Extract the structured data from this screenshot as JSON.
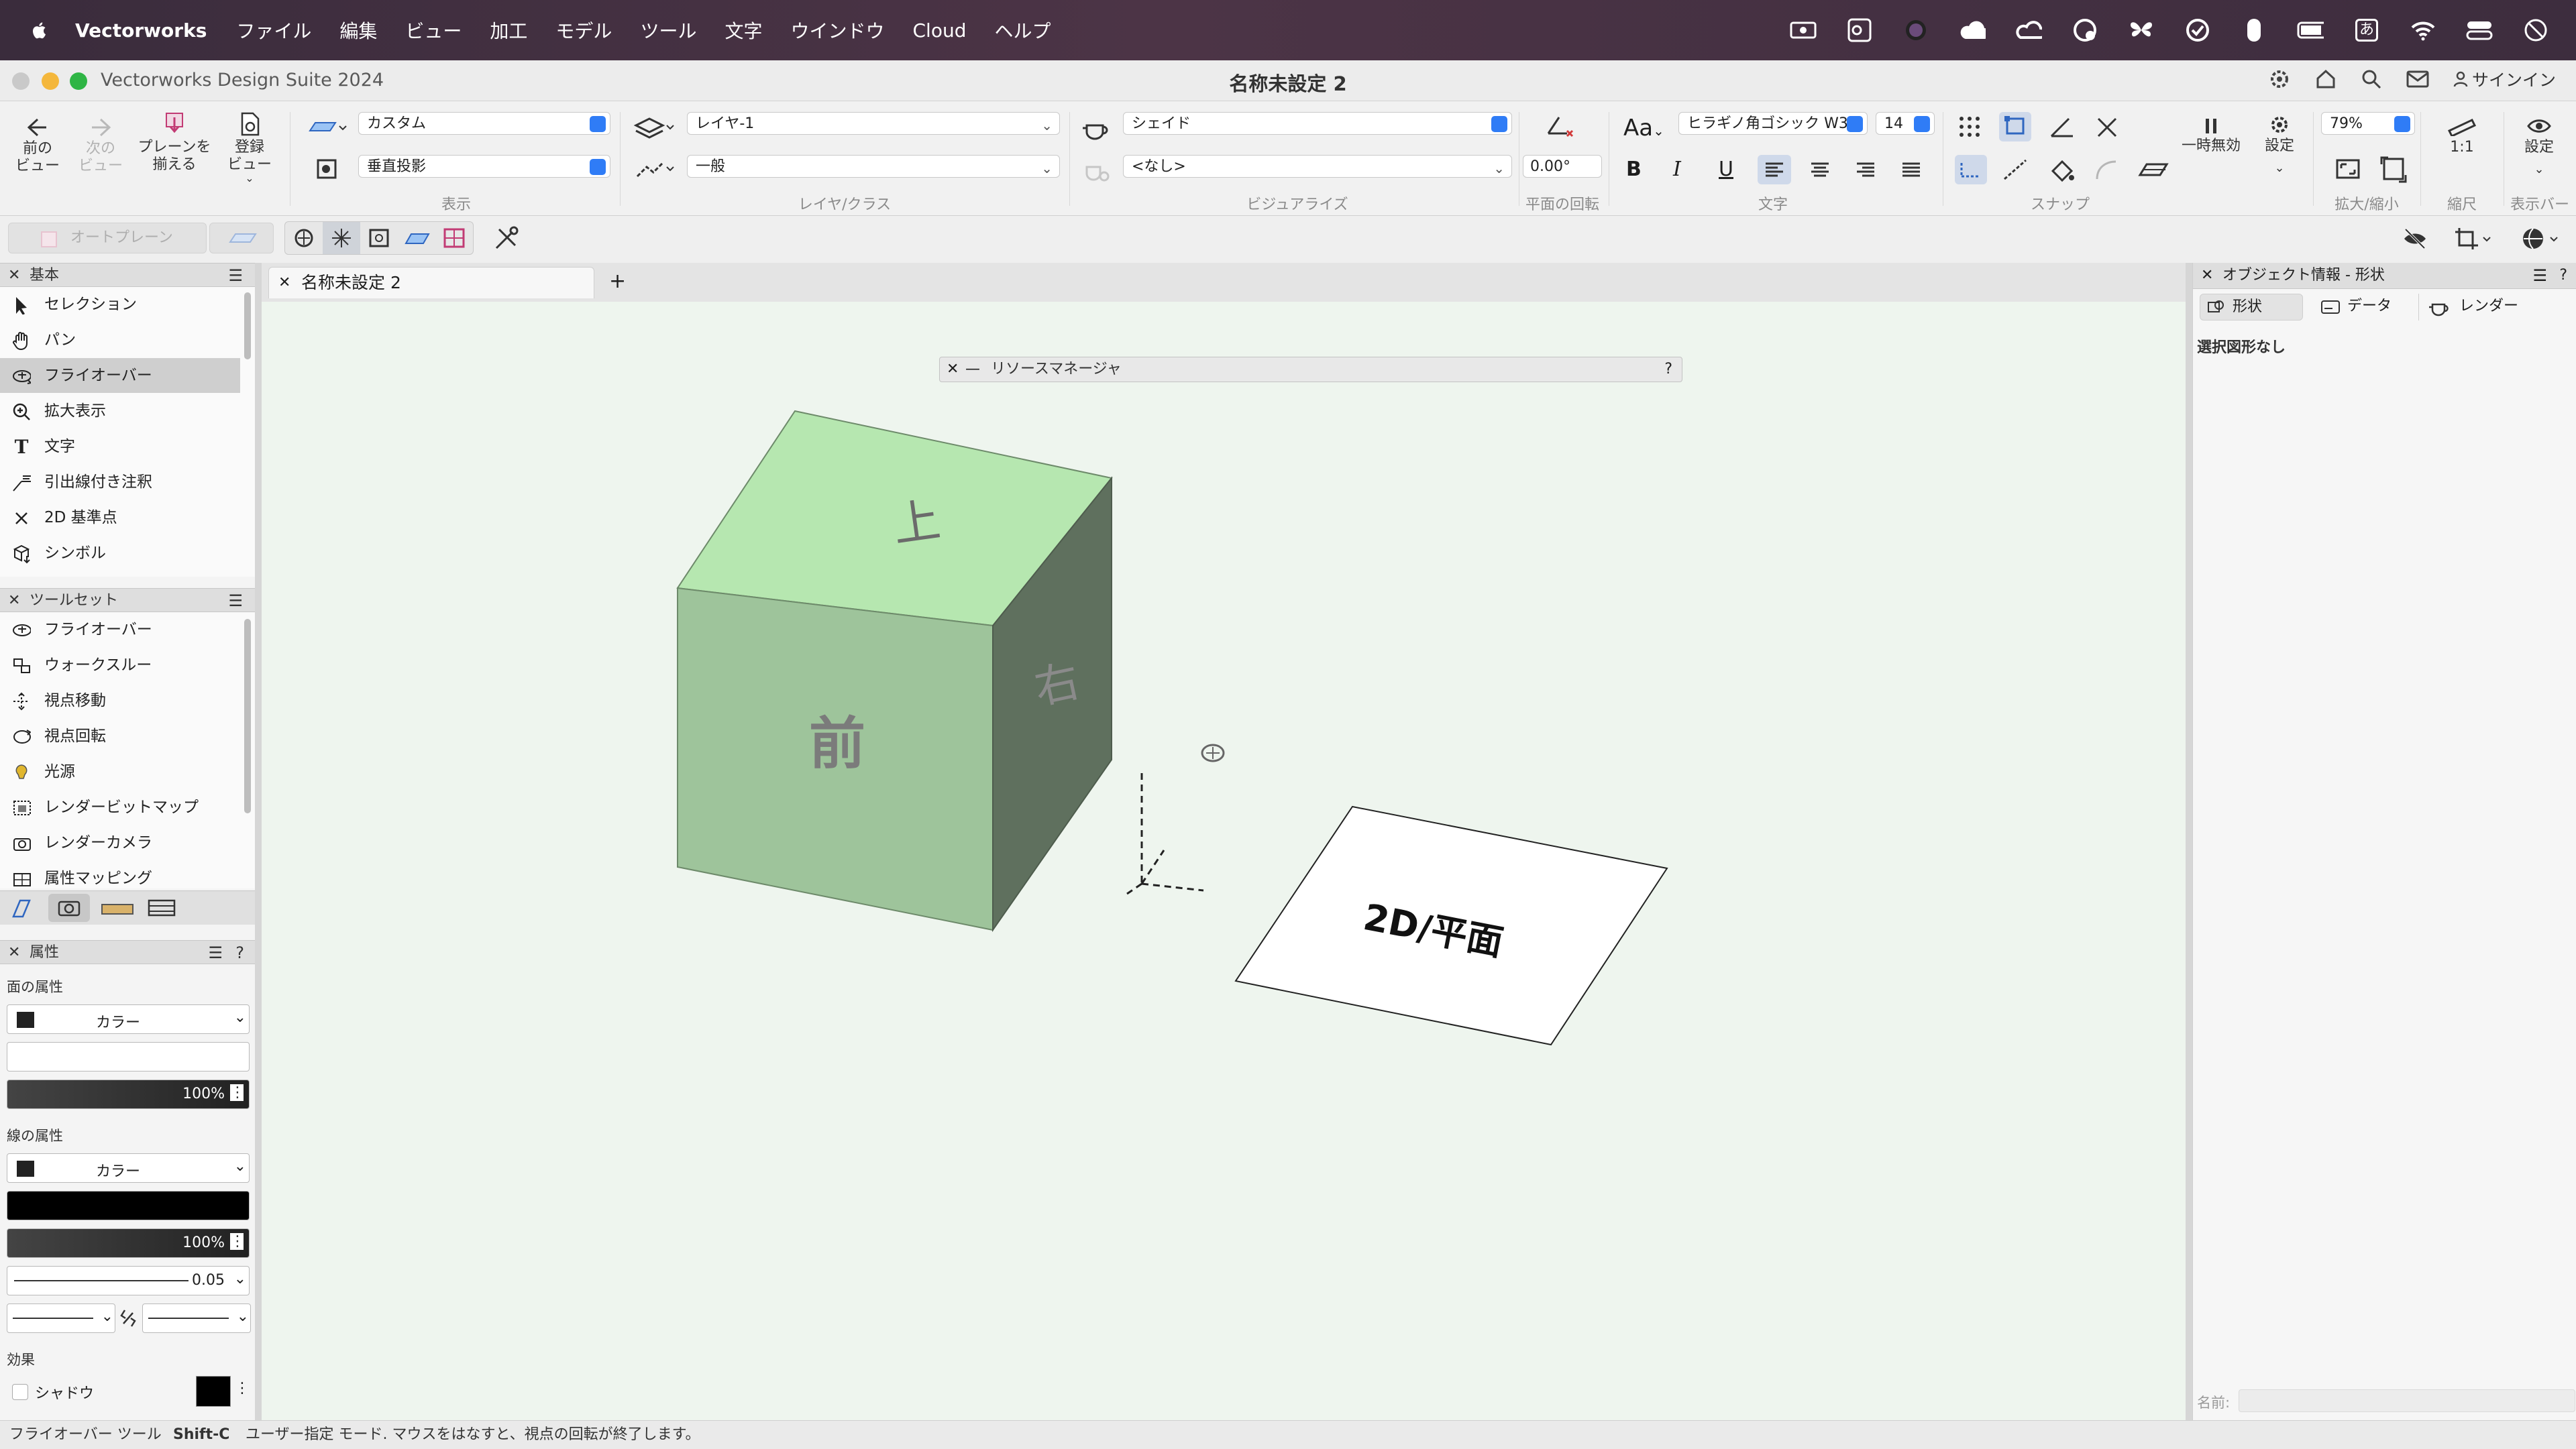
{
  "menubar": {
    "app_name": "Vectorworks",
    "items": [
      "ファイル",
      "編集",
      "ビュー",
      "加工",
      "モデル",
      "ツール",
      "文字",
      "ウインドウ",
      "Cloud",
      "ヘルプ"
    ],
    "status_icons": [
      "screen-record-icon",
      "outlook-icon",
      "siri-orb-icon",
      "cloud-icon",
      "creative-cloud-icon",
      "sync-icon",
      "butterfly-icon",
      "vpn-icon",
      "mouse-icon",
      "battery-charging-icon",
      "input-method-icon",
      "wifi-icon",
      "control-center-icon",
      "focus-icon"
    ],
    "input_method_label": "あ"
  },
  "titlebar": {
    "app_title": "Vectorworks Design Suite 2024",
    "document_title": "名称未設定 2",
    "signin_label": "サインイン"
  },
  "toolbar": {
    "prev_view_label": "前の\nビュー",
    "next_view_label": "次の\nビュー",
    "align_planes_label": "プレーンを\n揃える",
    "saved_view_label": "登録\nビュー",
    "view_group_label": "表示",
    "view_select": "カスタム",
    "projection_select": "垂直投影",
    "layer_select": "レイヤ-1",
    "class_select": "一般",
    "layer_class_group_label": "レイヤ/クラス",
    "render_select": "シェイド",
    "light_select": "<なし>",
    "visualize_group_label": "ビジュアライズ",
    "plane_rotation_value": "0.00°",
    "plane_rotation_label": "平面の回転",
    "font_select": "ヒラギノ角ゴシック W3",
    "font_size_select": "14",
    "text_group_label": "文字",
    "snap_group_label": "スナップ",
    "pause_label": "一時無効",
    "settings_label": "設定",
    "zoom_value": "79%",
    "zoom_group_label": "拡大/縮小",
    "scale_value": "1:1",
    "scale_group_label": "縮尺",
    "display_bar_settings_label": "設定",
    "display_bar_group_label": "表示バー",
    "text_format_buttons": [
      "B",
      "I",
      "U"
    ],
    "auto_plane_label": "オートプレーン"
  },
  "basic_palette": {
    "title": "基本",
    "tools": [
      {
        "icon": "arrow-pointer-icon",
        "label": "セレクション"
      },
      {
        "icon": "hand-icon",
        "label": "パン"
      },
      {
        "icon": "flyover-icon",
        "label": "フライオーバー",
        "active": true
      },
      {
        "icon": "zoom-icon",
        "label": "拡大表示"
      },
      {
        "icon": "text-tool-icon",
        "label": "文字"
      },
      {
        "icon": "callout-icon",
        "label": "引出線付き注釈"
      },
      {
        "icon": "locus-icon",
        "label": "2D 基準点"
      },
      {
        "icon": "symbol-icon",
        "label": "シンボル"
      }
    ]
  },
  "toolset_palette": {
    "title": "ツールセット",
    "tools": [
      {
        "icon": "flyover-icon",
        "label": "フライオーバー"
      },
      {
        "icon": "walkthrough-icon",
        "label": "ウォークスルー"
      },
      {
        "icon": "translate-view-icon",
        "label": "視点移動"
      },
      {
        "icon": "rotate-view-icon",
        "label": "視点回転"
      },
      {
        "icon": "light-icon",
        "label": "光源"
      },
      {
        "icon": "render-bitmap-icon",
        "label": "レンダービットマップ"
      },
      {
        "icon": "render-camera-icon",
        "label": "レンダーカメラ"
      },
      {
        "icon": "attribute-mapping-icon",
        "label": "属性マッピング"
      }
    ]
  },
  "attributes_palette": {
    "title": "属性",
    "fill_section_label": "面の属性",
    "fill_type": "カラー",
    "fill_opacity": "100%",
    "pen_section_label": "線の属性",
    "pen_type": "カラー",
    "pen_opacity": "100%",
    "line_thickness": "0.05",
    "effects_label": "効果",
    "shadow_label": "シャドウ",
    "colors": {
      "fill_swatch": "#222222",
      "pen_bar": "#000000"
    }
  },
  "drawing": {
    "tab_title": "名称未設定 2",
    "add_tab_label": "+",
    "resource_manager_title": "リソースマネージャ",
    "resource_manager_help": "?",
    "cube_top_label": "上",
    "cube_front_label": "前",
    "cube_side_label": "右",
    "plane_label": "2D/平面",
    "colors": {
      "canvas_bg": "#eef5ee",
      "cube_top": "#b6e7b0",
      "cube_front": "#9ec49b",
      "cube_side": "#5f705e"
    }
  },
  "object_info": {
    "title": "オブジェクト情報 - 形状",
    "tabs": [
      "形状",
      "データ",
      "レンダー"
    ],
    "empty_label": "選択図形なし",
    "name_label": "名前:"
  },
  "statusbar": {
    "tool_name": "フライオーバー ツール",
    "shortcut": "Shift-C",
    "message": "ユーザー指定 モード. マウスをはなすと、視点の回転が終了します。"
  }
}
